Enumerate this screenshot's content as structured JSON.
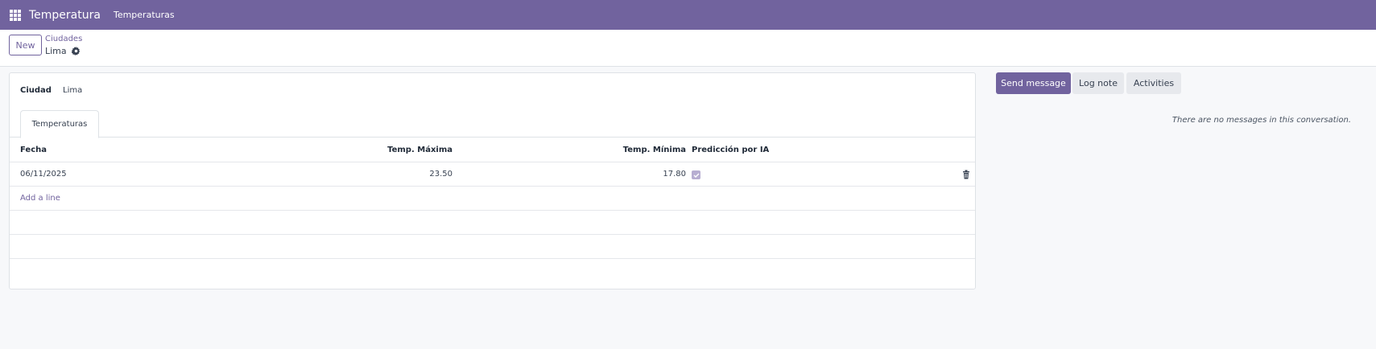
{
  "navbar": {
    "app_title": "Temperatura",
    "menu_item": "Temperaturas",
    "background": "#71639e"
  },
  "controlbar": {
    "new_label": "New",
    "breadcrumb_parent": "Ciudades",
    "record_name": "Lima"
  },
  "form": {
    "ciudad_label": "Ciudad",
    "ciudad_value": "Lima",
    "tab_label": "Temperaturas",
    "columns": [
      "Fecha",
      "Temp. Máxima",
      "Temp. Mínima",
      "Predicción por IA"
    ],
    "rows": [
      {
        "fecha": "06/11/2025",
        "max": "23.50",
        "min": "17.80",
        "ia": true
      }
    ],
    "add_line_label": "Add a line"
  },
  "chatter": {
    "send_message_label": "Send message",
    "log_note_label": "Log note",
    "activities_label": "Activities",
    "empty_text": "There are no messages in this conversation."
  },
  "icons": [
    "apps-grid-icon",
    "gear-icon",
    "checkbox-checked-icon",
    "trash-icon"
  ],
  "accent_color": "#71639e"
}
